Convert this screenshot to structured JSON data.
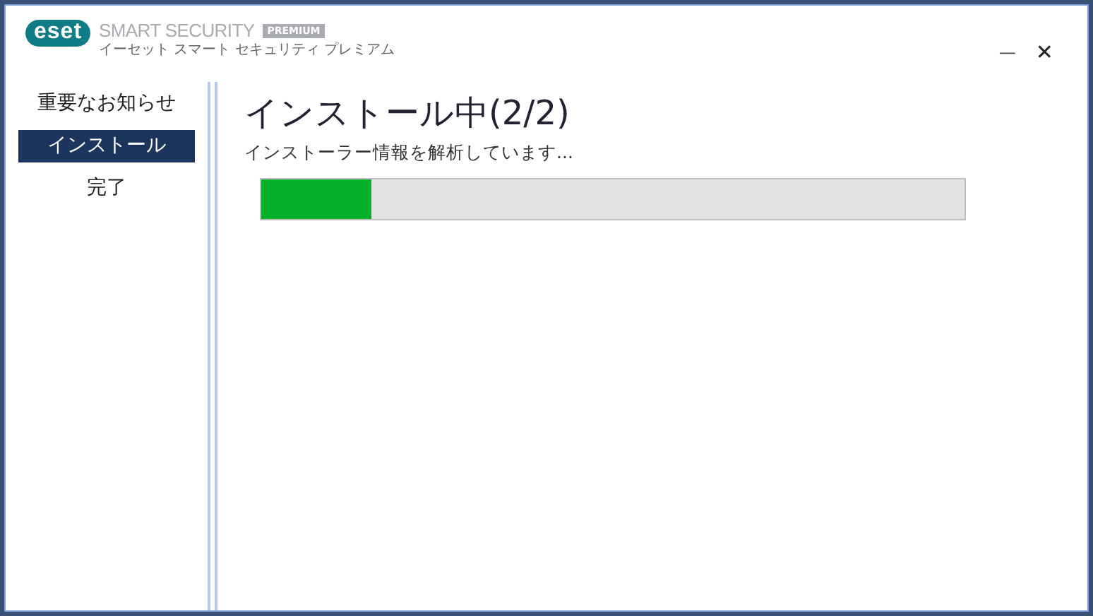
{
  "logo": {
    "mark": "eset",
    "product": "SMART SECURITY",
    "edition": "PREMIUM",
    "subtitle": "イーセット スマート セキュリティ プレミアム"
  },
  "window_controls": {
    "minimize": "—",
    "close": "✕"
  },
  "sidebar": {
    "items": [
      {
        "label": "重要なお知らせ",
        "selected": false
      },
      {
        "label": "インストール",
        "selected": true
      },
      {
        "label": "完了",
        "selected": false
      }
    ]
  },
  "content": {
    "title": "インストール中(2/2)",
    "status": "インストーラー情報を解析しています...",
    "progress": {
      "level": 0.156
    }
  }
}
